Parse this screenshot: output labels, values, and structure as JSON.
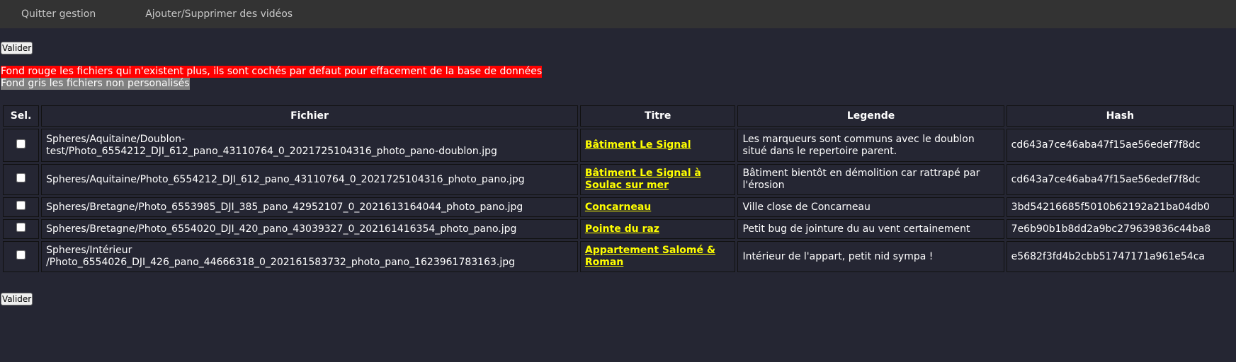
{
  "nav": {
    "items": [
      "Quitter gestion",
      "Ajouter/Supprimer des vidéos"
    ]
  },
  "buttons": {
    "submit_label": "Valider"
  },
  "notes": {
    "red": "Fond rouge les fichiers qui n'existent plus, ils sont cochés par defaut pour effacement de la base de données",
    "grey": "Fond gris les fichiers non personalisés"
  },
  "table": {
    "headers": [
      "Sel.",
      "Fichier",
      "Titre",
      "Legende",
      "Hash"
    ],
    "rows": [
      {
        "checked": false,
        "file": "Spheres/Aquitaine/Doublon-test/Photo_6554212_DJI_612_pano_43110764_0_2021725104316_photo_pano-doublon.jpg",
        "title": "Bâtiment Le Signal",
        "legend": "Les marqueurs sont communs avec le doublon situé dans le repertoire parent.",
        "hash": "cd643a7ce46aba47f15ae56edef7f8dc"
      },
      {
        "checked": false,
        "file": "Spheres/Aquitaine/Photo_6554212_DJI_612_pano_43110764_0_2021725104316_photo_pano.jpg",
        "title": "Bâtiment Le Signal à Soulac sur mer",
        "legend": "Bâtiment bientôt en démolition car rattrapé par l'érosion",
        "hash": "cd643a7ce46aba47f15ae56edef7f8dc"
      },
      {
        "checked": false,
        "file": "Spheres/Bretagne/Photo_6553985_DJI_385_pano_42952107_0_2021613164044_photo_pano.jpg",
        "title": "Concarneau",
        "legend": "Ville close de Concarneau",
        "hash": "3bd54216685f5010b62192a21ba04db0"
      },
      {
        "checked": false,
        "file": "Spheres/Bretagne/Photo_6554020_DJI_420_pano_43039327_0_202161416354_photo_pano.jpg",
        "title": "Pointe du raz",
        "legend": "Petit bug de jointure du au vent certainement",
        "hash": "7e6b90b1b8dd2a9bc279639836c44ba8"
      },
      {
        "checked": false,
        "file": "Spheres/Intérieur /Photo_6554026_DJI_426_pano_44666318_0_202161583732_photo_pano_1623961783163.jpg",
        "title": "Appartement Salomé & Roman",
        "legend": "Intérieur de l'appart, petit nid sympa !",
        "hash": "e5682f3fd4b2cbb51747171a961e54ca"
      }
    ]
  }
}
